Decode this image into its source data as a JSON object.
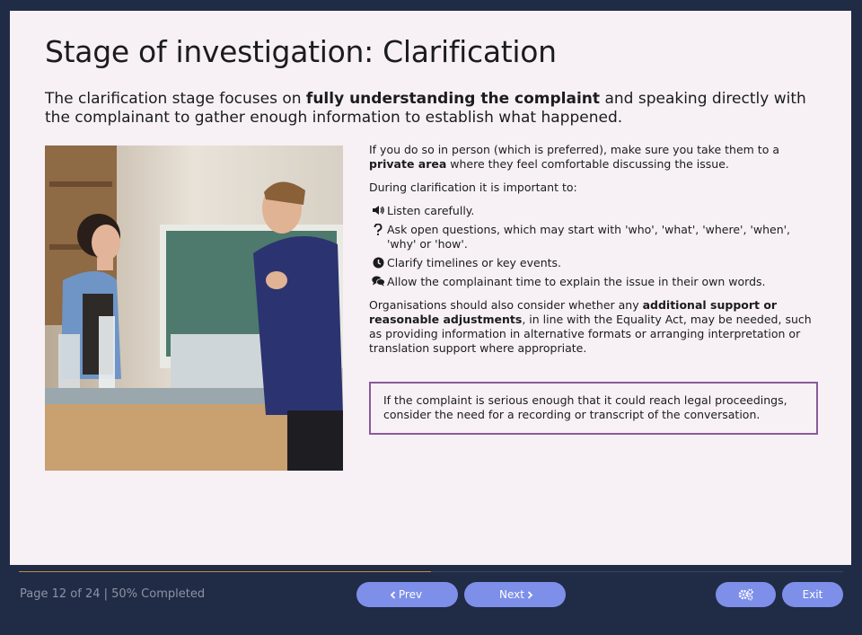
{
  "slide": {
    "title": "Stage of investigation: Clarification",
    "intro_before": "The clarification stage focuses on ",
    "intro_bold": "fully understanding the complaint",
    "intro_after": " and speaking directly with the complainant to gather enough information to establish what happened.",
    "photo_alt": "photo"
  },
  "content": {
    "p1_before": "If you do so in person (which is preferred), make sure you take them to a ",
    "p1_bold": "private area",
    "p1_after": " where they feel comfortable discussing the issue.",
    "p2": "During clarification it is important to:",
    "bullets": [
      {
        "icon": "speaker-icon",
        "text": "Listen carefully."
      },
      {
        "icon": "question-icon",
        "text": "Ask open questions, which may start with 'who', 'what', 'where', 'when', 'why' or 'how'."
      },
      {
        "icon": "clock-icon",
        "text": "Clarify timelines or key events."
      },
      {
        "icon": "chat-icon",
        "text": "Allow the complainant time to explain the issue in their own words."
      }
    ],
    "p3_before": "Organisations should also consider whether any ",
    "p3_bold": "additional support or reasonable adjustments",
    "p3_after": ", in line with the Equality Act, may be needed, such as providing information in alternative formats or arranging interpretation or translation support where appropriate.",
    "note": "If the complaint is serious enough that it could reach legal proceedings, consider the need for a recording or transcript of the conversation."
  },
  "footer": {
    "page_text": "Page 12 of 24",
    "separator": "|",
    "completed_text": "50% Completed",
    "progress_fraction": 0.5,
    "prev_label": "Prev",
    "next_label": "Next",
    "settings_icon": "gears-icon",
    "exit_label": "Exit"
  },
  "colors": {
    "background": "#202b45",
    "slide": "#f7f1f6",
    "button": "#7d8fe8",
    "note_border": "#8a5a9a",
    "progress": "#c08a4a"
  }
}
